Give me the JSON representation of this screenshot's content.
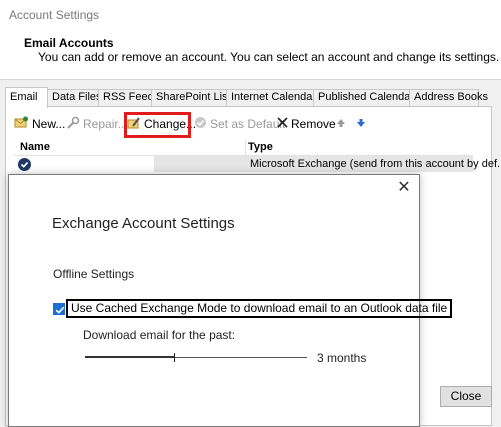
{
  "window": {
    "title": "Account Settings",
    "header_title": "Email Accounts",
    "header_desc": "You can add or remove an account. You can select an account and change its settings."
  },
  "tabs": [
    {
      "label": "Email",
      "active": true
    },
    {
      "label": "Data Files"
    },
    {
      "label": "RSS Feeds"
    },
    {
      "label": "SharePoint Lists"
    },
    {
      "label": "Internet Calendars"
    },
    {
      "label": "Published Calendars"
    },
    {
      "label": "Address Books"
    }
  ],
  "toolbar": {
    "new_label": "New...",
    "repair_label": "Repair...",
    "change_label": "Change...",
    "default_label": "Set as Default",
    "remove_label": "Remove",
    "highlight_color": "#e21b1b"
  },
  "list": {
    "col_name": "Name",
    "col_type": "Type",
    "rows": [
      {
        "name": "",
        "type": "Microsoft Exchange (send from this account by def..."
      }
    ]
  },
  "close_label": "Close",
  "dialog": {
    "title": "Exchange Account Settings",
    "section": "Offline Settings",
    "cached_mode_label": "Use Cached Exchange Mode to download email to an Outlook data file",
    "cached_mode_checked": true,
    "download_label": "Download email for the past:",
    "slider_value": "3 months",
    "slider_fraction": 0.4
  },
  "colors": {
    "accent": "#1d6fd1",
    "selection": "#e5e5e5"
  }
}
